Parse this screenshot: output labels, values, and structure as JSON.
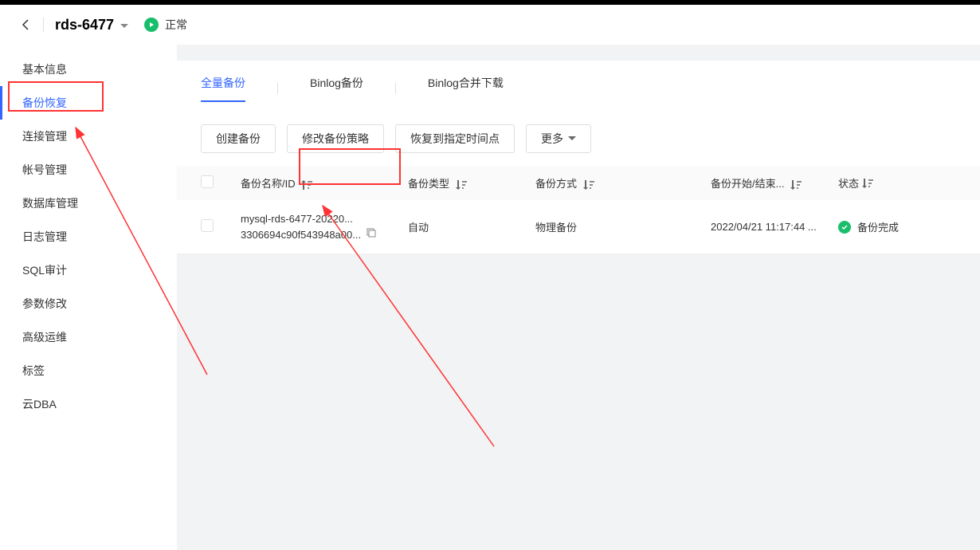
{
  "header": {
    "instance_name": "rds-6477",
    "status_text": "正常"
  },
  "sidebar": {
    "items": [
      {
        "label": "基本信息",
        "name": "sidebar-item-basic-info"
      },
      {
        "label": "备份恢复",
        "name": "sidebar-item-backup-restore",
        "active": true
      },
      {
        "label": "连接管理",
        "name": "sidebar-item-connection"
      },
      {
        "label": "帐号管理",
        "name": "sidebar-item-account"
      },
      {
        "label": "数据库管理",
        "name": "sidebar-item-database"
      },
      {
        "label": "日志管理",
        "name": "sidebar-item-logs"
      },
      {
        "label": "SQL审计",
        "name": "sidebar-item-sql-audit"
      },
      {
        "label": "参数修改",
        "name": "sidebar-item-params"
      },
      {
        "label": "高级运维",
        "name": "sidebar-item-advanced"
      },
      {
        "label": "标签",
        "name": "sidebar-item-tags"
      },
      {
        "label": "云DBA",
        "name": "sidebar-item-cloud-dba"
      }
    ]
  },
  "tabs": {
    "items": [
      {
        "label": "全量备份",
        "active": true
      },
      {
        "label": "Binlog备份"
      },
      {
        "label": "Binlog合并下载"
      }
    ]
  },
  "toolbar": {
    "create_backup": "创建备份",
    "modify_policy": "修改备份策略",
    "restore_to_time": "恢复到指定时间点",
    "more": "更多"
  },
  "table": {
    "headers": {
      "name": "备份名称/ID",
      "type": "备份类型",
      "method": "备份方式",
      "time": "备份开始/结束...",
      "status": "状态"
    },
    "rows": [
      {
        "name_line1": "mysql-rds-6477-20220...",
        "name_line2": "3306694c90f543948a00...",
        "type": "自动",
        "method": "物理备份",
        "time": "2022/04/21 11:17:44 ...",
        "status": "备份完成"
      }
    ]
  }
}
